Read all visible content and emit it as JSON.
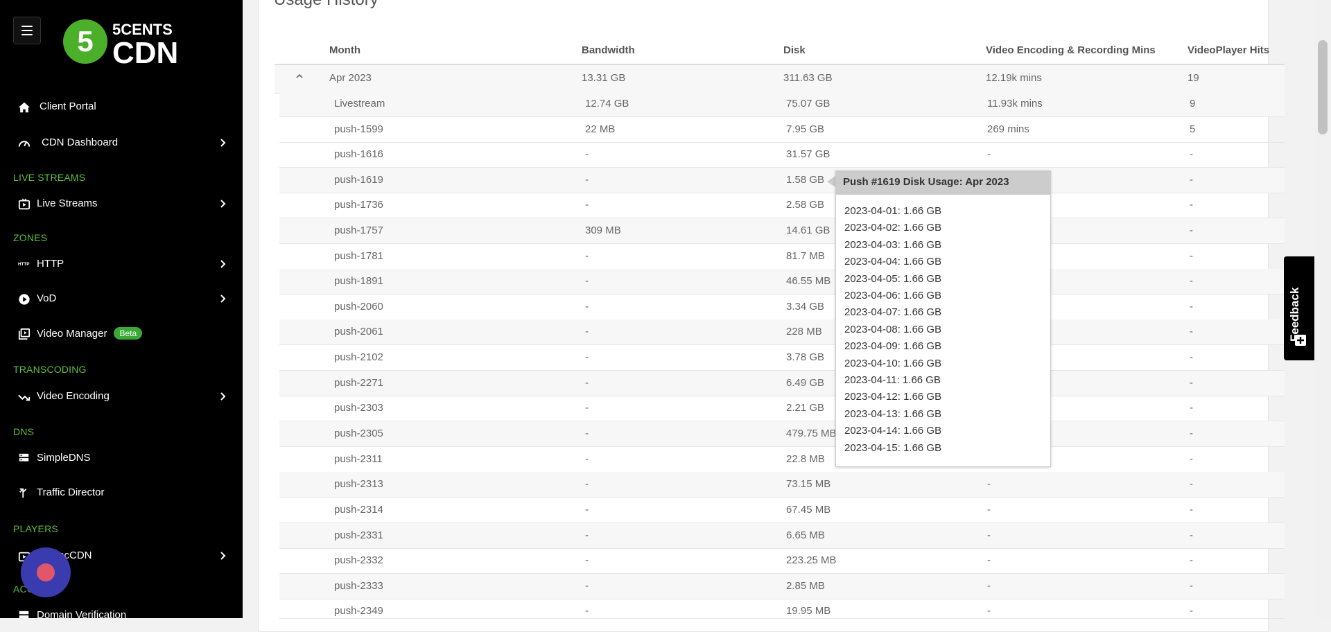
{
  "brand": {
    "logo_digit": "5",
    "logo_line1": "5CENTS",
    "logo_line2": "CDN"
  },
  "sidebar": {
    "items": [
      {
        "label": "Client Portal"
      },
      {
        "label": "CDN Dashboard"
      },
      {
        "label": "Live Streams"
      },
      {
        "label": "HTTP"
      },
      {
        "label": "VoD"
      },
      {
        "label": "Video Manager",
        "badge": "Beta"
      },
      {
        "label": "Video Encoding"
      },
      {
        "label": "SimpleDNS"
      },
      {
        "label": "Traffic Director"
      },
      {
        "label": "5centsCDN",
        "visible_label": "scCDN"
      },
      {
        "label": "Domain Verification"
      }
    ],
    "sections": [
      "LIVE STREAMS",
      "ZONES",
      "TRANSCODING",
      "DNS",
      "PLAYERS",
      "ACC"
    ]
  },
  "page": {
    "title": "Usage History"
  },
  "table": {
    "columns": [
      "Month",
      "Bandwidth",
      "Disk",
      "Video Encoding & Recording Mins",
      "VideoPlayer Hits"
    ],
    "month_row": {
      "month": "Apr 2023",
      "bandwidth": "13.31 GB",
      "disk": "311.63 GB",
      "mins": "12.19k mins",
      "hits": "19"
    },
    "rows": [
      {
        "name": "Livestream",
        "bandwidth": "12.74 GB",
        "disk": "75.07 GB",
        "mins": "11.93k mins",
        "hits": "9"
      },
      {
        "name": "push-1599",
        "bandwidth": "22 MB",
        "disk": "7.95 GB",
        "mins": "269 mins",
        "hits": "5"
      },
      {
        "name": "push-1616",
        "bandwidth": "-",
        "disk": "31.57 GB",
        "mins": "-",
        "hits": "-"
      },
      {
        "name": "push-1619",
        "bandwidth": "-",
        "disk": "1.58 GB",
        "mins": "-",
        "hits": "-"
      },
      {
        "name": "push-1736",
        "bandwidth": "-",
        "disk": "2.58 GB",
        "mins": "-",
        "hits": "-"
      },
      {
        "name": "push-1757",
        "bandwidth": "309 MB",
        "disk": "14.61 GB",
        "mins": "-",
        "hits": "-"
      },
      {
        "name": "push-1781",
        "bandwidth": "-",
        "disk": "81.7 MB",
        "mins": "-",
        "hits": "-"
      },
      {
        "name": "push-1891",
        "bandwidth": "-",
        "disk": "46.55 MB",
        "mins": "-",
        "hits": "-"
      },
      {
        "name": "push-2060",
        "bandwidth": "-",
        "disk": "3.34 GB",
        "mins": "-",
        "hits": "-"
      },
      {
        "name": "push-2061",
        "bandwidth": "-",
        "disk": "228 MB",
        "mins": "-",
        "hits": "-"
      },
      {
        "name": "push-2102",
        "bandwidth": "-",
        "disk": "3.78 GB",
        "mins": "-",
        "hits": "-"
      },
      {
        "name": "push-2271",
        "bandwidth": "-",
        "disk": "6.49 GB",
        "mins": "-",
        "hits": "-"
      },
      {
        "name": "push-2303",
        "bandwidth": "-",
        "disk": "2.21 GB",
        "mins": "-",
        "hits": "-"
      },
      {
        "name": "push-2305",
        "bandwidth": "-",
        "disk": "479.75 MB",
        "mins": "-",
        "hits": "-"
      },
      {
        "name": "push-2311",
        "bandwidth": "-",
        "disk": "22.8 MB",
        "mins": "-",
        "hits": "-"
      },
      {
        "name": "push-2313",
        "bandwidth": "-",
        "disk": "73.15 MB",
        "mins": "-",
        "hits": "-"
      },
      {
        "name": "push-2314",
        "bandwidth": "-",
        "disk": "67.45 MB",
        "mins": "-",
        "hits": "-"
      },
      {
        "name": "push-2331",
        "bandwidth": "-",
        "disk": "6.65 MB",
        "mins": "-",
        "hits": "-"
      },
      {
        "name": "push-2332",
        "bandwidth": "-",
        "disk": "223.25 MB",
        "mins": "-",
        "hits": "-"
      },
      {
        "name": "push-2333",
        "bandwidth": "-",
        "disk": "2.85 MB",
        "mins": "-",
        "hits": "-"
      },
      {
        "name": "push-2349",
        "bandwidth": "-",
        "disk": "19.95 MB",
        "mins": "-",
        "hits": "-"
      }
    ]
  },
  "tooltip": {
    "title": "Push #1619 Disk Usage: Apr 2023",
    "lines": [
      "2023-04-01: 1.66 GB",
      "2023-04-02: 1.66 GB",
      "2023-04-03: 1.66 GB",
      "2023-04-04: 1.66 GB",
      "2023-04-05: 1.66 GB",
      "2023-04-06: 1.66 GB",
      "2023-04-07: 1.66 GB",
      "2023-04-08: 1.66 GB",
      "2023-04-09: 1.66 GB",
      "2023-04-10: 1.66 GB",
      "2023-04-11: 1.66 GB",
      "2023-04-12: 1.66 GB",
      "2023-04-13: 1.66 GB",
      "2023-04-14: 1.66 GB",
      "2023-04-15: 1.66 GB"
    ]
  },
  "feedback": {
    "label": "Feedback"
  },
  "colors": {
    "sidebar_bg": "#000000",
    "section_green": "#5fbf3f",
    "beta_badge": "#3aa935",
    "logo_green": "#4caf2a",
    "chat_bubble": "#3b3bb0"
  }
}
